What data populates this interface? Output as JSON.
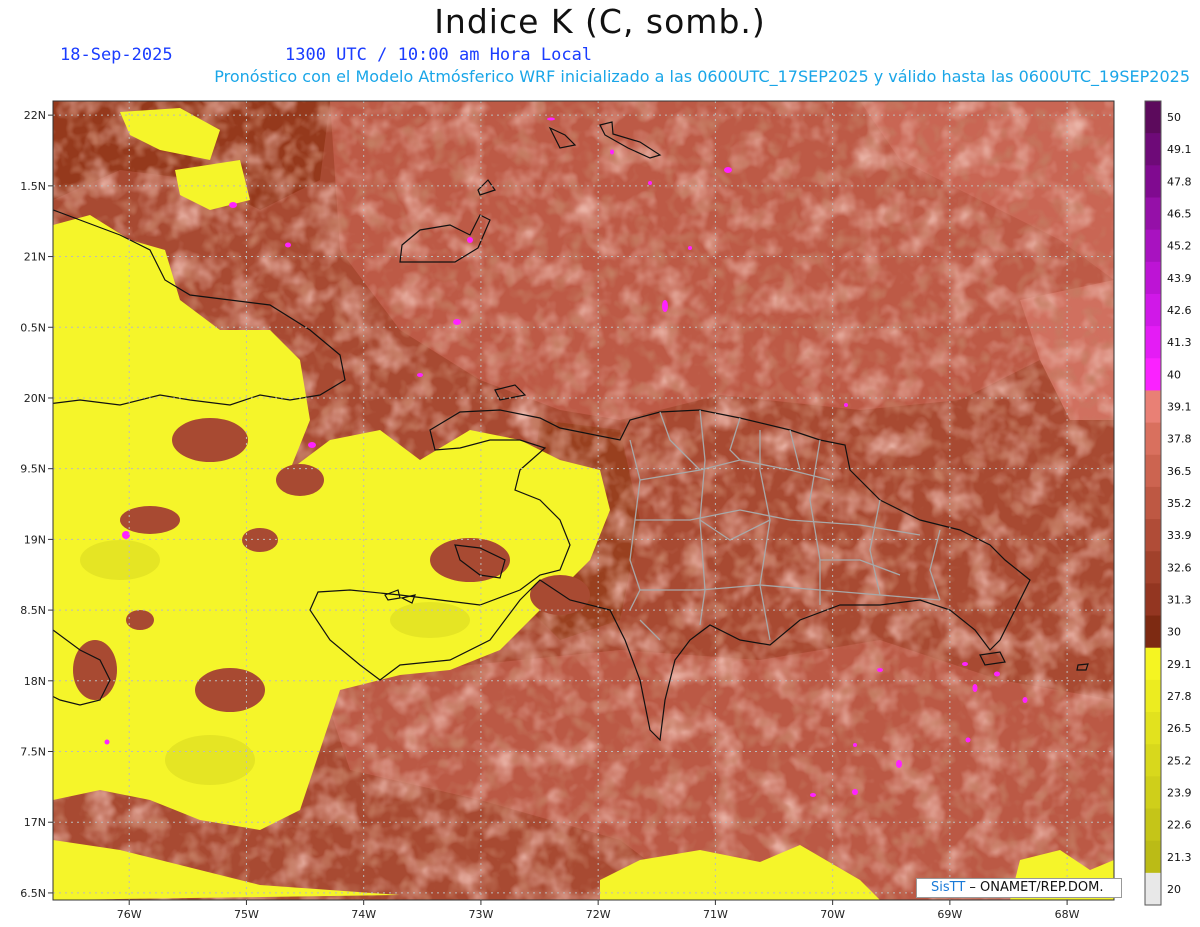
{
  "header": {
    "title": "Indice K (C, somb.)",
    "date": "18-Sep-2025",
    "time": "1300 UTC / 10:00 am Hora Local",
    "forecast": "Pronóstico con el Modelo Atmósferico WRF inicializado a las 0600UTC_17SEP2025 y válido hasta las  0600UTC_19SEP2025"
  },
  "map": {
    "lon_range": [
      -76.65,
      -67.6
    ],
    "lat_range": [
      16.45,
      22.1
    ],
    "lat_ticks": [
      {
        "lat": 22.0,
        "label": "22N"
      },
      {
        "lat": 21.5,
        "label": "1.5N"
      },
      {
        "lat": 21.0,
        "label": "21N"
      },
      {
        "lat": 20.5,
        "label": "0.5N"
      },
      {
        "lat": 20.0,
        "label": "20N"
      },
      {
        "lat": 19.5,
        "label": "9.5N"
      },
      {
        "lat": 19.0,
        "label": "19N"
      },
      {
        "lat": 18.5,
        "label": "8.5N"
      },
      {
        "lat": 18.0,
        "label": "18N"
      },
      {
        "lat": 17.5,
        "label": "7.5N"
      },
      {
        "lat": 17.0,
        "label": "17N"
      },
      {
        "lat": 16.5,
        "label": "6.5N"
      }
    ],
    "lon_ticks": [
      {
        "lon": -76,
        "label": "76W"
      },
      {
        "lon": -75,
        "label": "75W"
      },
      {
        "lon": -74,
        "label": "74W"
      },
      {
        "lon": -73,
        "label": "73W"
      },
      {
        "lon": -72,
        "label": "72W"
      },
      {
        "lon": -71,
        "label": "71W"
      },
      {
        "lon": -70,
        "label": "70W"
      },
      {
        "lon": -69,
        "label": "69W"
      },
      {
        "lon": -68,
        "label": "68W"
      }
    ],
    "field_colors": {
      "dark_brown": "#93391f",
      "mid_brown": "#a84a32",
      "salmon": "#c25d4a",
      "light_salmon": "#d47262",
      "yellow": "#f5f52a",
      "olive_yellow": "#dede22",
      "magenta": "#ff22ff",
      "coast": "#111111",
      "province": "#a8a8a8",
      "grid": "#bbbbbb"
    }
  },
  "colorbar": {
    "labels": [
      "50",
      "49.1",
      "47.8",
      "46.5",
      "45.2",
      "43.9",
      "42.6",
      "41.3",
      "40",
      "39.1",
      "37.8",
      "36.5",
      "35.2",
      "33.9",
      "32.6",
      "31.3",
      "30",
      "29.1",
      "27.8",
      "26.5",
      "25.2",
      "23.9",
      "22.6",
      "21.3",
      "20"
    ],
    "colors": [
      "#5c0a5c",
      "#6e0a78",
      "#800a90",
      "#9510a8",
      "#a812c0",
      "#bd14d5",
      "#d018e8",
      "#e41cf5",
      "#fa22ff",
      "#e98075",
      "#d9705e",
      "#cc6450",
      "#be5843",
      "#b04c37",
      "#a1412b",
      "#933621",
      "#7d2a12",
      "#f5f522",
      "#ecec20",
      "#e2e21e",
      "#d8d81c",
      "#cfcf1a",
      "#c5c518",
      "#bbbb16",
      "#e8e8e8"
    ]
  },
  "credit": {
    "brand": "SisTT",
    "text": " – ONAMET/REP.DOM."
  }
}
